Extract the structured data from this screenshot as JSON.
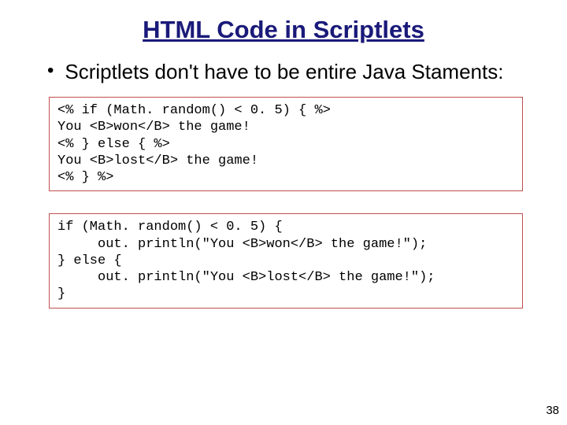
{
  "title": "HTML Code in Scriptlets",
  "bullet": {
    "text": "Scriptlets don't have to be entire Java Staments:"
  },
  "code1": "<% if (Math. random() < 0. 5) { %>\nYou <B>won</B> the game!\n<% } else { %>\nYou <B>lost</B> the game!\n<% } %>",
  "code2": "if (Math. random() < 0. 5) {\n     out. println(\"You <B>won</B> the game!\");\n} else {\n     out. println(\"You <B>lost</B> the game!\");\n}",
  "page_number": "38"
}
